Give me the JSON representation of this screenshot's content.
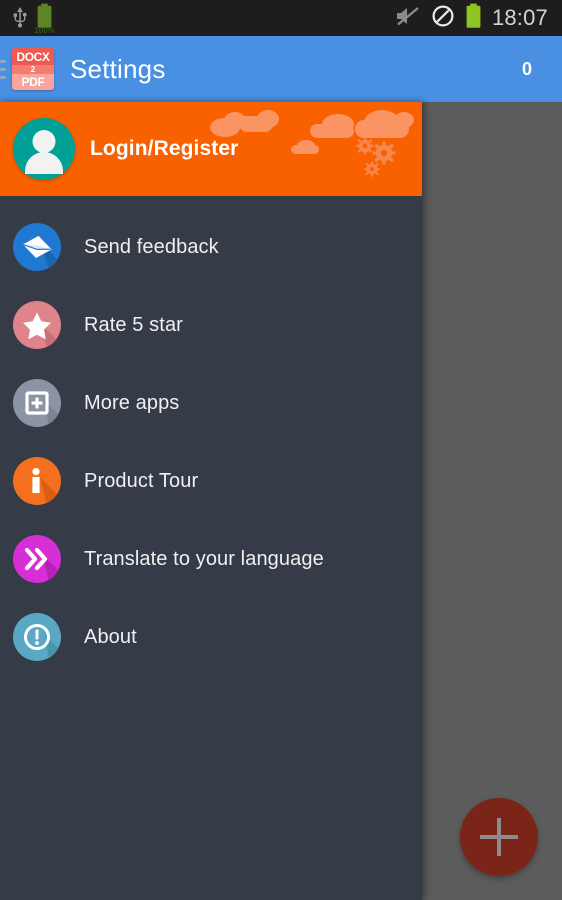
{
  "status_bar": {
    "usb_icon": "usb-icon",
    "battery_left_icon": "battery-icon",
    "battery_percent": "100%",
    "mute_icon": "volume-mute-icon",
    "dnd_icon": "do-not-disturb-icon",
    "battery_right_icon": "battery-icon",
    "time": "18:07",
    "background": "#1d1d1d"
  },
  "app_bar": {
    "menu_icon": "hamburger-menu-icon",
    "logo": {
      "top_text": "DOCX",
      "middle_text": "2",
      "bottom_text": "PDF"
    },
    "title": "Settings",
    "count": "0",
    "background": "#4a90e2"
  },
  "drawer": {
    "background": "#353b47",
    "header": {
      "label": "Login/Register",
      "avatar_icon": "user-avatar-icon",
      "avatar_color": "#00a096",
      "background": "#f96000",
      "decoration_color": "#fb9463"
    },
    "items": [
      {
        "label": "Send feedback",
        "icon": "envelope-icon",
        "color": "#1f78d1",
        "shadow": "#1a66b0"
      },
      {
        "label": "Rate 5 star",
        "icon": "star-icon",
        "color": "#e0848c",
        "shadow": "#cc7078"
      },
      {
        "label": "More apps",
        "icon": "add-box-icon",
        "color": "#8b94a4",
        "shadow": "#7b8494"
      },
      {
        "label": "Product Tour",
        "icon": "person-icon",
        "color": "#f4701e",
        "shadow": "#d85f12"
      },
      {
        "label": "Translate to your language",
        "icon": "double-chevron-icon",
        "color": "#d62fd6",
        "shadow": "#b821b8"
      },
      {
        "label": "About",
        "icon": "info-exclamation-icon",
        "color": "#5aa8c4",
        "shadow": "#4a94af"
      }
    ]
  },
  "content": {
    "scrim_color": "#5c5c5c",
    "fab": {
      "icon": "plus-icon",
      "color": "#7b2518",
      "label": "+"
    }
  }
}
